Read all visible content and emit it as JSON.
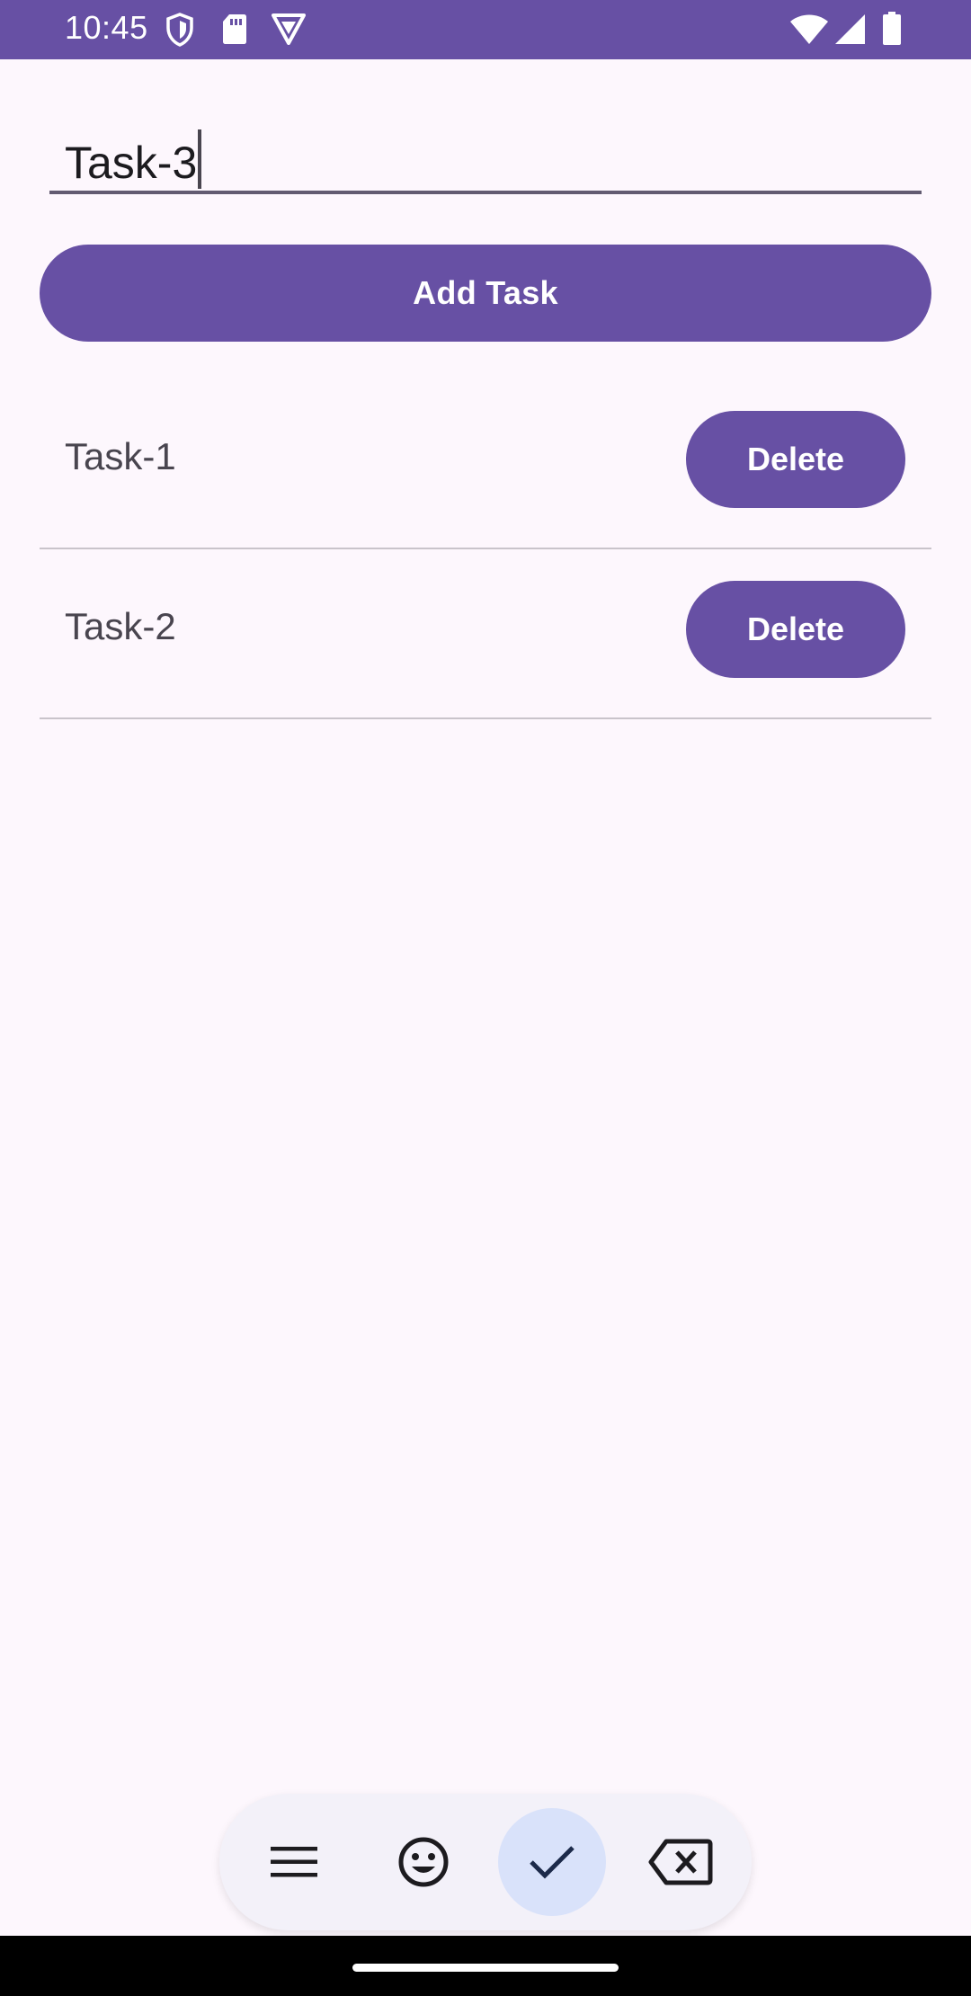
{
  "status_bar": {
    "time": "10:45",
    "icons_left": [
      "shield-icon",
      "sd-card-icon",
      "vpn-icon"
    ],
    "icons_right": [
      "wifi-icon",
      "signal-icon",
      "battery-icon"
    ],
    "color": "#6750A4"
  },
  "task_input": {
    "value": "Task-3",
    "placeholder": ""
  },
  "add_button": {
    "label": "Add Task"
  },
  "tasks": [
    {
      "label": "Task-1",
      "delete_label": "Delete"
    },
    {
      "label": "Task-2",
      "delete_label": "Delete"
    }
  ],
  "keyboard_toolbar": {
    "icons": [
      "menu-icon",
      "emoji-icon",
      "check-icon",
      "backspace-icon"
    ]
  },
  "colors": {
    "primary": "#6750A4",
    "background": "#FDF7FD",
    "toolbar": "#F3F1F9",
    "toolbar_active": "#D9E2FA"
  }
}
